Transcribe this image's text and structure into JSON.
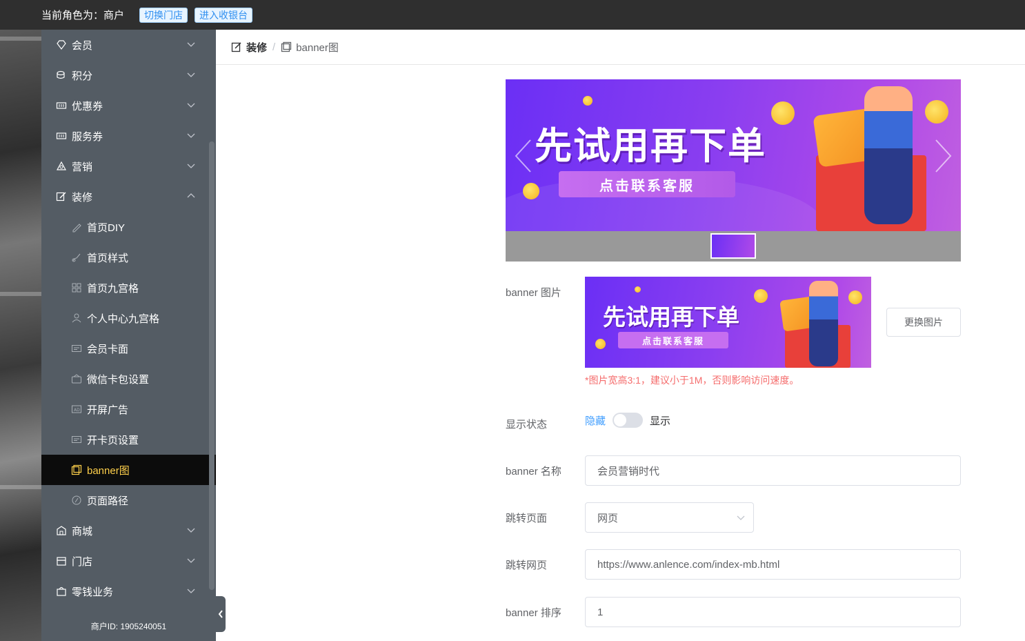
{
  "topbar": {
    "role_text": "当前角色为：商户",
    "switch_store": "切换门店",
    "enter_cashier": "进入收银台"
  },
  "sidebar": {
    "items": [
      {
        "label": "会员",
        "icon": "diamond-icon",
        "expandable": true
      },
      {
        "label": "积分",
        "icon": "coins-icon",
        "expandable": true
      },
      {
        "label": "优惠券",
        "icon": "ticket-icon",
        "expandable": true
      },
      {
        "label": "服务券",
        "icon": "ticket-icon",
        "expandable": true
      },
      {
        "label": "营销",
        "icon": "chart-icon",
        "expandable": true
      },
      {
        "label": "装修",
        "icon": "edit-icon",
        "expandable": true,
        "expanded": true
      },
      {
        "label": "首页DIY",
        "icon": "pencil-icon"
      },
      {
        "label": "首页样式",
        "icon": "brush-icon"
      },
      {
        "label": "首页九宫格",
        "icon": "grid-icon"
      },
      {
        "label": "个人中心九宫格",
        "icon": "user-icon"
      },
      {
        "label": "会员卡面",
        "icon": "card-icon"
      },
      {
        "label": "微信卡包设置",
        "icon": "wallet-icon"
      },
      {
        "label": "开屏广告",
        "icon": "ad-icon"
      },
      {
        "label": "开卡页设置",
        "icon": "card-icon"
      },
      {
        "label": "banner图",
        "icon": "image-icon",
        "active": true
      },
      {
        "label": "页面路径",
        "icon": "path-icon"
      },
      {
        "label": "商城",
        "icon": "shop-icon",
        "expandable": true
      },
      {
        "label": "门店",
        "icon": "store-icon",
        "expandable": true
      },
      {
        "label": "零钱业务",
        "icon": "bag-icon",
        "expandable": true
      }
    ],
    "merchant_id": "商户ID:  1905240051"
  },
  "breadcrumb": {
    "parent": "装修",
    "separator": "/",
    "current": "banner图"
  },
  "preview": {
    "headline": "先试用再下单",
    "pill_text": "点击联系客服",
    "thumb_headline": "先试用再下单"
  },
  "form": {
    "banner_image_label": "banner 图片",
    "change_image_button": "更换图片",
    "hint": "*图片宽高3:1，建议小于1M，否则影响访问速度。",
    "display_status_label": "显示状态",
    "toggle_off_label": "隐藏",
    "toggle_on_label": "显示",
    "toggle_value": false,
    "banner_name_label": "banner 名称",
    "banner_name_value": "会员营销时代",
    "jump_page_label": "跳转页面",
    "jump_page_value": "网页",
    "jump_url_label": "跳转网页",
    "jump_url_value": "https://www.anlence.com/index-mb.html",
    "sort_label": "banner 排序",
    "sort_value": "1"
  },
  "colors": {
    "topbar": "#2f2f2f",
    "sidebar": "#545c64",
    "active_text": "#ffd04b",
    "link_blue": "#409eff",
    "hint_red": "#f56c6c"
  }
}
